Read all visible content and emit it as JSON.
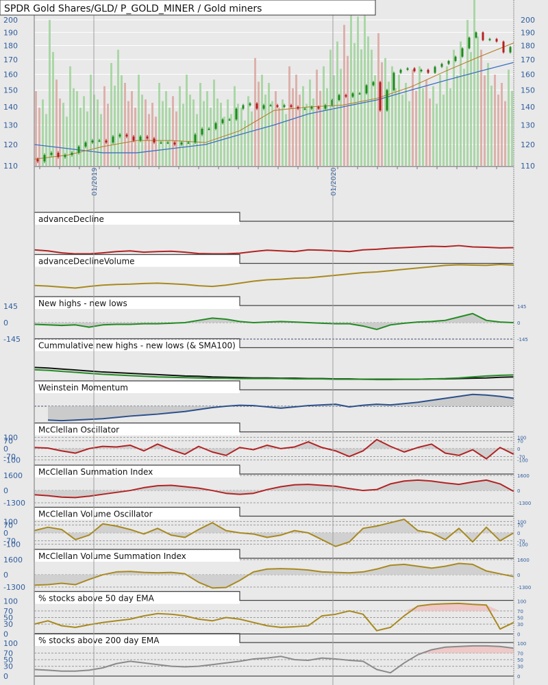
{
  "chart_data": {
    "type": "line",
    "main": {
      "title": "SPDR Gold Shares/GLD/ P_GOLD_MINER / Gold miners",
      "price_ticks": [
        110,
        120,
        130,
        140,
        150,
        160,
        170,
        180,
        190,
        200
      ],
      "ylim": [
        110,
        200
      ],
      "date_labels": [
        "01/2019",
        "01/2020"
      ],
      "close": [
        113,
        112,
        115,
        116,
        114,
        115,
        116,
        119,
        121,
        122,
        122,
        121,
        124,
        125,
        124,
        122,
        124,
        123,
        121,
        121,
        121,
        120,
        121,
        121,
        125,
        128,
        128,
        131,
        133,
        133,
        139,
        141,
        142,
        139,
        141,
        141,
        140,
        141,
        140,
        139,
        139,
        140,
        139,
        141,
        144,
        147,
        146,
        148,
        148,
        153,
        155,
        138,
        150,
        161,
        163,
        164,
        162,
        163,
        161,
        165,
        167,
        169,
        172,
        178,
        186,
        190,
        184,
        185,
        183,
        175,
        179
      ],
      "sma_brown": [
        113,
        115,
        119,
        122,
        122,
        121,
        127,
        138,
        140,
        141,
        145,
        152,
        162,
        172,
        182
      ],
      "sma_blue": [
        120,
        118,
        116,
        116,
        118,
        120,
        125,
        130,
        136,
        140,
        144,
        150,
        156,
        162,
        168
      ],
      "volume_pct": [
        45,
        40,
        88,
        52,
        38,
        60,
        45,
        42,
        55,
        40,
        48,
        62,
        70,
        50,
        45,
        55,
        40,
        38,
        50,
        45,
        42,
        48,
        55,
        40,
        50,
        45,
        52,
        38,
        40,
        48,
        35,
        42,
        65,
        55,
        50,
        45,
        40,
        60,
        55,
        48,
        52,
        58,
        60,
        70,
        75,
        85,
        95,
        90,
        100,
        70,
        80,
        65,
        60,
        55,
        50,
        58,
        60,
        52,
        48,
        55,
        60,
        70,
        75,
        88,
        100,
        70,
        62,
        55,
        50,
        58
      ],
      "colors": {
        "up": "#1f8a1f",
        "down": "#b52020",
        "vol_up": "#9fd39a",
        "vol_down": "#d9a7a0",
        "brown": "#b07a20",
        "blue": "#3a6fc4"
      }
    },
    "panels": [
      {
        "title": "advanceDecline",
        "ylim": [
          0,
          100
        ],
        "left_ticks": [],
        "right_ticks": [],
        "levels": [],
        "series": [
          {
            "color": "#b22222",
            "values": [
              15,
              12,
              6,
              3,
              3,
              6,
              10,
              12,
              8,
              10,
              11,
              8,
              4,
              3,
              3,
              5,
              10,
              14,
              12,
              10,
              15,
              14,
              12,
              10,
              15,
              17,
              20,
              22,
              24,
              26,
              25,
              28,
              24,
              23,
              21,
              22
            ]
          }
        ]
      },
      {
        "title": "advanceDeclineVolume",
        "ylim": [
          0,
          100
        ],
        "left_ticks": [],
        "right_ticks": [],
        "levels": [],
        "series": [
          {
            "color": "#a8891e",
            "values": [
              35,
              33,
              30,
              27,
              32,
              36,
              38,
              39,
              41,
              42,
              40,
              38,
              34,
              32,
              36,
              42,
              48,
              52,
              54,
              57,
              58,
              62,
              66,
              70,
              74,
              76,
              80,
              84,
              88,
              92,
              96,
              98,
              97,
              96,
              99,
              97
            ]
          }
        ]
      },
      {
        "title": "New highs - new lows",
        "ylim": [
          -145,
          145
        ],
        "left_ticks": [
          145,
          0,
          -145
        ],
        "right_ticks": [
          145,
          0,
          -145
        ],
        "levels": [
          0,
          -145
        ],
        "fill": {
          "base": 0,
          "mode": "both",
          "color": "#c8c8c8"
        },
        "series": [
          {
            "color": "#228b22",
            "values": [
              -15,
              -20,
              -25,
              -20,
              -40,
              -20,
              -15,
              -15,
              -10,
              -10,
              -5,
              0,
              20,
              40,
              30,
              10,
              0,
              5,
              10,
              5,
              0,
              -5,
              -10,
              -10,
              -30,
              -60,
              -20,
              -5,
              5,
              10,
              20,
              50,
              80,
              20,
              5,
              0
            ]
          }
        ]
      },
      {
        "title": "Cummulative new highs - new lows (& SMA100)",
        "ylim": [
          0,
          100
        ],
        "left_ticks": [],
        "right_ticks": [],
        "levels": [],
        "series": [
          {
            "color": "#111111",
            "values": [
              42,
              40,
              37,
              34,
              31,
              28,
              26,
              24,
              22,
              20,
              18,
              16,
              15,
              13,
              12,
              11,
              10,
              10,
              9,
              9,
              8,
              8,
              7,
              7,
              6,
              6,
              6,
              6,
              6,
              7,
              7,
              8,
              9,
              10,
              12,
              13
            ]
          },
          {
            "color": "#228b22",
            "values": [
              35,
              33,
              30,
              27,
              24,
              21,
              19,
              17,
              15,
              13,
              12,
              11,
              10,
              9,
              9,
              8,
              8,
              8,
              8,
              7,
              7,
              7,
              6,
              6,
              6,
              5,
              5,
              6,
              6,
              7,
              8,
              10,
              13,
              16,
              18,
              19
            ]
          }
        ]
      },
      {
        "title": "Weinstein Momentum",
        "ylim": [
          0,
          100
        ],
        "left_ticks": [],
        "right_ticks": [],
        "levels": [
          52
        ],
        "fill": {
          "base": 52,
          "mode": "both",
          "color": "#c8c8c8"
        },
        "series": [
          {
            "color": "#2b4f8a",
            "values": [
              null,
              10,
              8,
              10,
              12,
              14,
              18,
              22,
              25,
              28,
              32,
              36,
              42,
              48,
              52,
              55,
              54,
              50,
              46,
              50,
              54,
              56,
              58,
              50,
              55,
              58,
              56,
              60,
              64,
              70,
              76,
              82,
              88,
              86,
              82,
              76
            ]
          }
        ]
      },
      {
        "title": "McClellan Oscillator",
        "ylim": [
          -149,
          142
        ],
        "left_ticks": [
          100,
          70,
          0,
          -70,
          -100
        ],
        "right_ticks": [
          100,
          70,
          0,
          -70,
          -100
        ],
        "levels": [
          100,
          70,
          0,
          -70,
          -100
        ],
        "fill": {
          "base": 0,
          "mode": "both",
          "color": "#cdcdcd"
        },
        "series": [
          {
            "color": "#b22222",
            "values": [
              10,
              5,
              -20,
              -40,
              0,
              20,
              15,
              30,
              -20,
              40,
              -10,
              -50,
              20,
              -30,
              -60,
              10,
              -10,
              30,
              0,
              15,
              60,
              10,
              -20,
              -70,
              -20,
              80,
              20,
              -30,
              10,
              40,
              -40,
              -60,
              -10,
              -90,
              10,
              -50
            ]
          }
        ]
      },
      {
        "title": "McClellan Summation Index",
        "ylim": [
          -1809,
          1672
        ],
        "left_ticks": [
          1600,
          0,
          -1300
        ],
        "right_ticks": [
          1600,
          0,
          -1300
        ],
        "levels": [
          1600,
          0,
          -1300
        ],
        "fill": {
          "base": 0,
          "mode": "both",
          "color": "#cdcdcd"
        },
        "series": [
          {
            "color": "#b22222",
            "values": [
              -450,
              -550,
              -700,
              -750,
              -600,
              -400,
              -200,
              0,
              300,
              500,
              550,
              400,
              250,
              0,
              -300,
              -400,
              -300,
              100,
              400,
              600,
              650,
              550,
              450,
              200,
              0,
              100,
              700,
              1000,
              1100,
              1000,
              800,
              650,
              900,
              1100,
              700,
              -100
            ]
          }
        ]
      },
      {
        "title": "McClellan Volume Oscillator",
        "ylim": [
          -149,
          142
        ],
        "left_ticks": [
          100,
          70,
          0,
          -70,
          -100
        ],
        "right_ticks": [
          100,
          70,
          0,
          -70,
          -100
        ],
        "levels": [
          100,
          70,
          0,
          -70,
          -100
        ],
        "fill": {
          "base": 0,
          "mode": "both",
          "color": "#cdcdcd"
        },
        "series": [
          {
            "color": "#a8891e",
            "values": [
              20,
              50,
              30,
              -60,
              -20,
              80,
              60,
              30,
              -10,
              40,
              -20,
              -40,
              30,
              90,
              20,
              0,
              -10,
              -40,
              -20,
              20,
              0,
              -60,
              -120,
              -80,
              40,
              60,
              90,
              120,
              20,
              0,
              -60,
              40,
              -80,
              50,
              -70,
              0
            ]
          }
        ]
      },
      {
        "title": "McClellan Volume Summation Index",
        "ylim": [
          -1809,
          1672
        ],
        "left_ticks": [
          1600,
          0,
          -1300
        ],
        "right_ticks": [
          1600,
          0,
          -1300
        ],
        "levels": [
          1600,
          0,
          -1300
        ],
        "fill": {
          "base": 0,
          "mode": "both",
          "color": "#cdcdcd"
        },
        "series": [
          {
            "color": "#a8891e",
            "values": [
              -1100,
              -1050,
              -900,
              -1050,
              -500,
              0,
              300,
              350,
              250,
              200,
              250,
              100,
              -800,
              -1400,
              -1350,
              -600,
              300,
              600,
              650,
              600,
              500,
              300,
              250,
              200,
              300,
              600,
              1000,
              1100,
              900,
              700,
              900,
              1200,
              1100,
              400,
              100,
              -200
            ]
          }
        ]
      },
      {
        "title": "% stocks above 50 day EMA",
        "ylim": [
          0,
          100
        ],
        "left_ticks": [
          100,
          70,
          50,
          30,
          0
        ],
        "right_ticks": [
          100,
          70,
          50,
          30,
          0
        ],
        "levels": [
          70,
          50,
          30
        ],
        "fill": {
          "base": 70,
          "mode": "above",
          "color": "#f0c4c4"
        },
        "series": [
          {
            "color": "#a8891e",
            "values": [
              30,
              40,
              25,
              20,
              28,
              35,
              40,
              45,
              55,
              62,
              60,
              55,
              45,
              40,
              50,
              45,
              35,
              25,
              20,
              22,
              25,
              55,
              60,
              70,
              60,
              10,
              20,
              55,
              85,
              90,
              92,
              93,
              90,
              88,
              15,
              35
            ]
          }
        ]
      },
      {
        "title": "% stocks above 200 day EMA",
        "ylim": [
          0,
          100
        ],
        "left_ticks": [
          100,
          70,
          50,
          30,
          0
        ],
        "right_ticks": [
          100,
          70,
          50,
          30,
          0
        ],
        "levels": [
          70,
          50,
          30
        ],
        "fill": {
          "base": 70,
          "mode": "above",
          "color": "#f0c4c4"
        },
        "series": [
          {
            "color": "#8a8a8a",
            "values": [
              20,
              18,
              15,
              15,
              18,
              25,
              38,
              45,
              40,
              35,
              30,
              28,
              30,
              35,
              40,
              45,
              52,
              55,
              60,
              50,
              48,
              55,
              52,
              48,
              45,
              20,
              10,
              40,
              65,
              80,
              88,
              90,
              92,
              92,
              90,
              85
            ]
          }
        ]
      }
    ]
  }
}
